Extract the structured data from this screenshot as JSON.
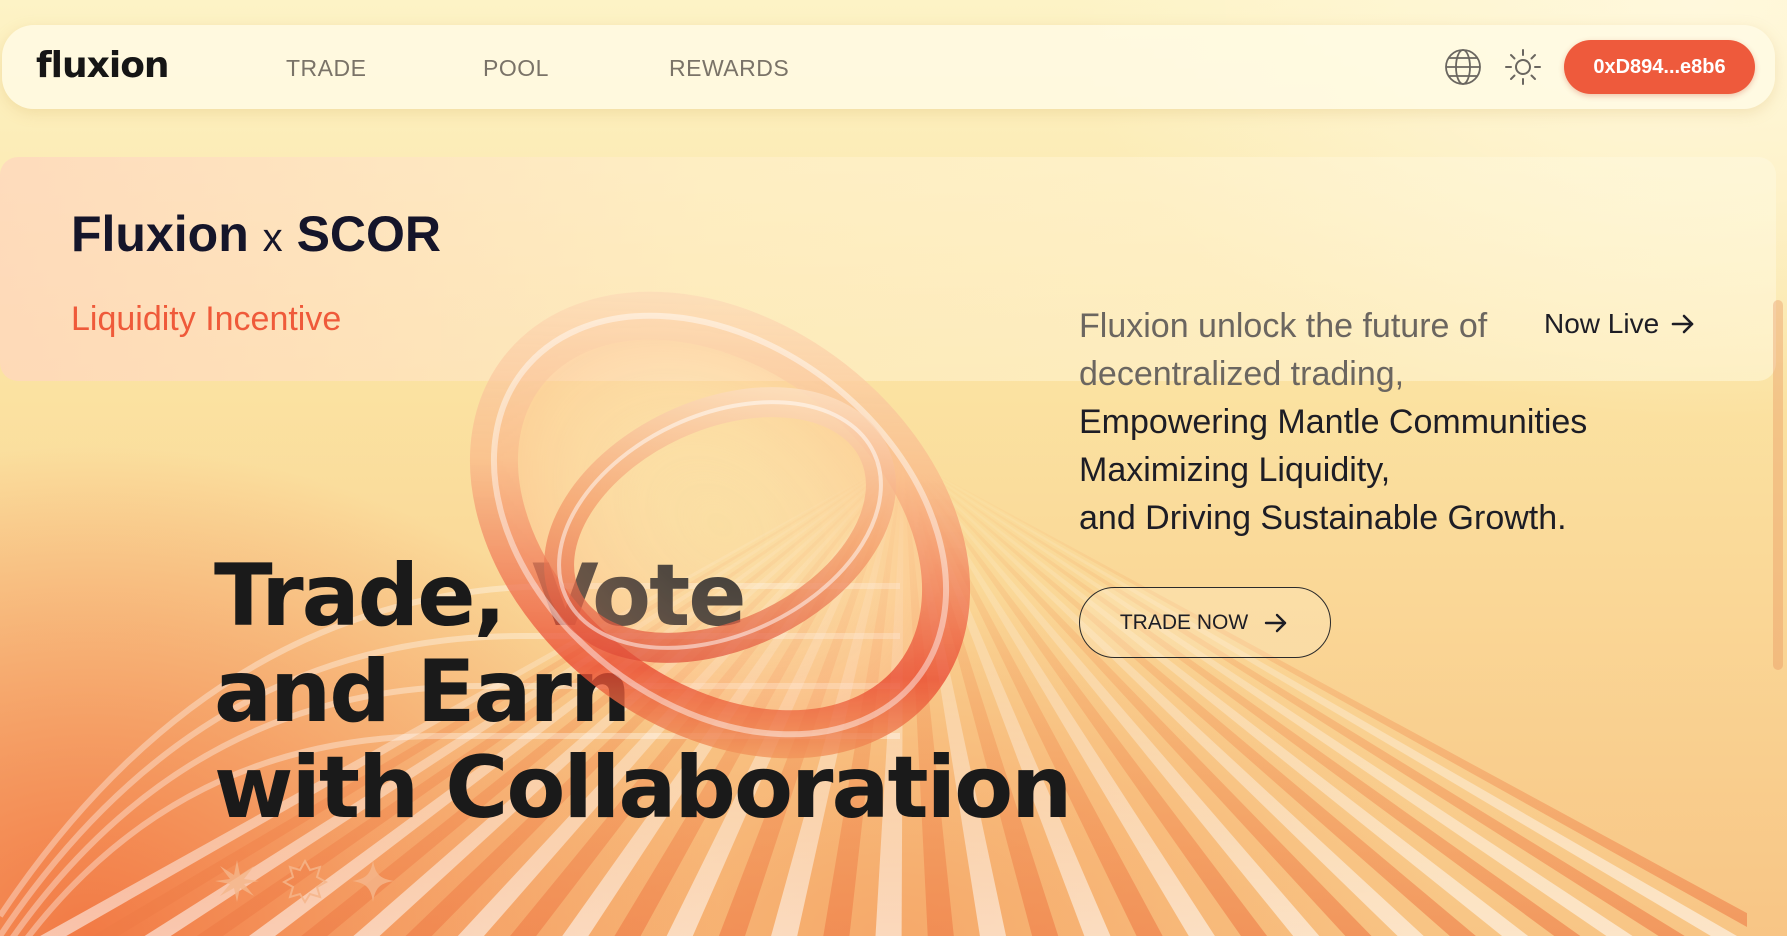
{
  "brand": {
    "logo_text": "fluxion"
  },
  "nav": {
    "links": [
      "TRADE",
      "POOL",
      "REWARDS"
    ],
    "icons": [
      "globe-icon",
      "sun-icon"
    ],
    "wallet_address": "0xD894...e8b6"
  },
  "banner": {
    "title_left": "Fluxion",
    "title_x": "x",
    "title_right": "SCOR",
    "subtitle": "Liquidity Incentive"
  },
  "hero": {
    "headline": [
      "Trade, Vote",
      "and Earn",
      "with Collaboration"
    ]
  },
  "description": {
    "lines_muted": [
      "Fluxion unlock the future of",
      "decentralized trading,"
    ],
    "lines_dark": [
      "Empowering Mantle Communities",
      "Maximizing Liquidity,",
      "and Driving Sustainable Growth."
    ],
    "now_live": "Now Live",
    "cta": "TRADE NOW"
  },
  "colors": {
    "accent": "#ee5a3c",
    "text_dark": "#1a1a1a",
    "subtitle": "#ef5a3a"
  }
}
